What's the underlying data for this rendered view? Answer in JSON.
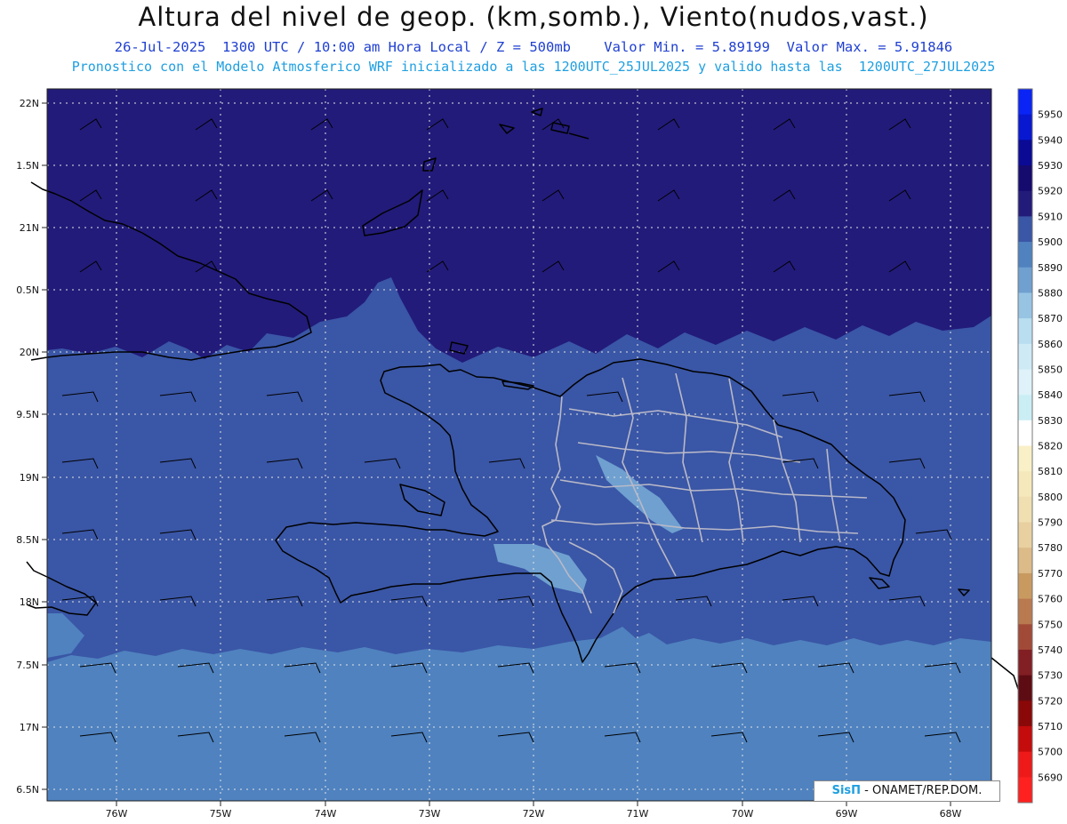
{
  "header": {
    "title": "Altura del nivel de geop. (km,somb.), Viento(nudos,vast.)",
    "subtitle": "26-Jul-2025  1300 UTC / 10:00 am Hora Local / Z = 500mb    Valor Min. = 5.89199  Valor Max. = 5.91846",
    "subtitle2": "Pronostico con el Modelo Atmosferico WRF inicializado a las 1200UTC_25JUL2025 y valido hasta las  1200UTC_27JUL2025"
  },
  "map": {
    "lat_ticks": [
      "22N",
      "1.5N",
      "21N",
      "0.5N",
      "20N",
      "9.5N",
      "19N",
      "8.5N",
      "18N",
      "7.5N",
      "17N",
      "6.5N"
    ],
    "lon_ticks": [
      "76W",
      "75W",
      "74W",
      "73W",
      "72W",
      "71W",
      "70W",
      "69W",
      "68W"
    ],
    "bands": [
      {
        "level": 5910,
        "color": "#221b7a"
      },
      {
        "level": 5900,
        "color": "#3a56a6"
      },
      {
        "level": 5890,
        "color": "#4f82bf"
      },
      {
        "level": 5880,
        "color": "#6fa0d0"
      }
    ]
  },
  "colorbar": {
    "levels": [
      {
        "label": "5950",
        "color": "#0a24f5"
      },
      {
        "label": "5940",
        "color": "#0818d0"
      },
      {
        "label": "5930",
        "color": "#0a0a95"
      },
      {
        "label": "5920",
        "color": "#150a6e"
      },
      {
        "label": "5910",
        "color": "#221b7a"
      },
      {
        "label": "5900",
        "color": "#3a56a6"
      },
      {
        "label": "5890",
        "color": "#4f82bf"
      },
      {
        "label": "5880",
        "color": "#6fa0d0"
      },
      {
        "label": "5870",
        "color": "#98c4e4"
      },
      {
        "label": "5860",
        "color": "#b8def0"
      },
      {
        "label": "5850",
        "color": "#cdeaf5"
      },
      {
        "label": "5840",
        "color": "#dff2f9"
      },
      {
        "label": "5830",
        "color": "#cbeef5"
      },
      {
        "label": "5820",
        "color": "#ffffff"
      },
      {
        "label": "5810",
        "color": "#faf0c8"
      },
      {
        "label": "5800",
        "color": "#f5e8bb"
      },
      {
        "label": "5790",
        "color": "#f0dfb0"
      },
      {
        "label": "5780",
        "color": "#e8d0a0"
      },
      {
        "label": "5770",
        "color": "#dcbb88"
      },
      {
        "label": "5760",
        "color": "#c99a60"
      },
      {
        "label": "5750",
        "color": "#b97a50"
      },
      {
        "label": "5740",
        "color": "#a24a38"
      },
      {
        "label": "5730",
        "color": "#821f24"
      },
      {
        "label": "5720",
        "color": "#5e0c14"
      },
      {
        "label": "5710",
        "color": "#8a0808"
      },
      {
        "label": "5700",
        "color": "#c40c0c"
      },
      {
        "label": "5690",
        "color": "#ee1a1a"
      },
      {
        "label": "",
        "color": "#ff2020"
      }
    ]
  },
  "credit": {
    "brand": "SisΠ",
    "text": " - ONAMET/REP.DOM."
  }
}
